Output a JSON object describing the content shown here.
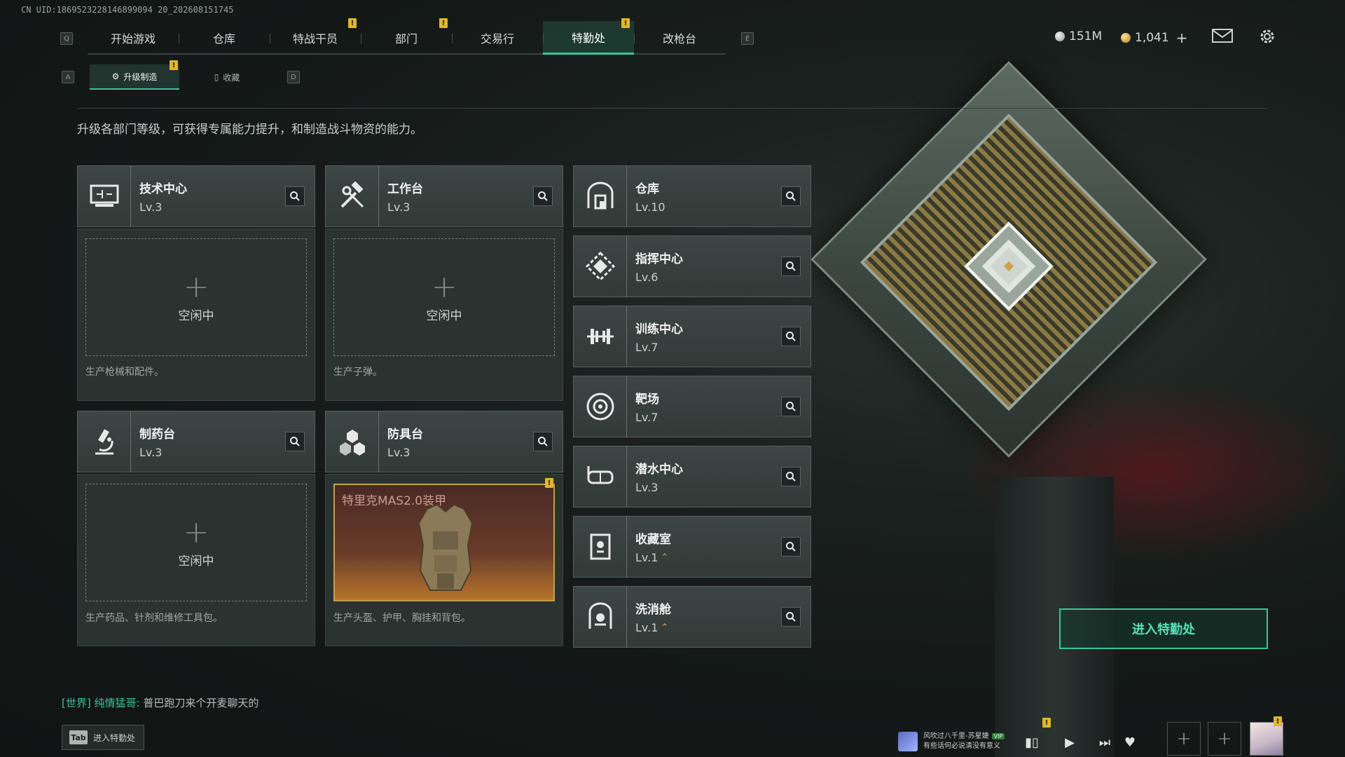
{
  "uid": "CN UID:1869523228146899094 20_202608151745",
  "keys": {
    "q": "Q",
    "e": "E",
    "a": "A",
    "d": "D"
  },
  "topnav": {
    "tabs": [
      {
        "label": "开始游戏"
      },
      {
        "label": "仓库"
      },
      {
        "label": "特战干员",
        "badge": "!"
      },
      {
        "label": "部门",
        "badge": "!"
      },
      {
        "label": "交易行"
      },
      {
        "label": "特勤处",
        "badge": "!",
        "active": true
      },
      {
        "label": "改枪台"
      }
    ]
  },
  "currency": {
    "silver": "151M",
    "gold": "1,041",
    "add": "+"
  },
  "subnav": {
    "tabs": [
      {
        "label": "升级制造",
        "badge": "!",
        "active": true
      },
      {
        "label": "收藏"
      }
    ]
  },
  "description": "升级各部门等级，可获得专属能力提升，和制造战斗物资的能力。",
  "workstations": [
    {
      "name": "技术中心",
      "level": "Lv.3",
      "slot": "空闲中",
      "note": "生产枪械和配件。"
    },
    {
      "name": "工作台",
      "level": "Lv.3",
      "slot": "空闲中",
      "note": "生产子弹。"
    },
    {
      "name": "制药台",
      "level": "Lv.3",
      "slot": "空闲中",
      "note": "生产药品、针剂和维修工具包。"
    },
    {
      "name": "防具台",
      "level": "Lv.3",
      "slot_item": "特里克MAS2.0装甲",
      "badge": "!",
      "note": "生产头盔、护甲、胸挂和背包。"
    }
  ],
  "departments": [
    {
      "name": "仓库",
      "level": "Lv.10"
    },
    {
      "name": "指挥中心",
      "level": "Lv.6"
    },
    {
      "name": "训练中心",
      "level": "Lv.7"
    },
    {
      "name": "靶场",
      "level": "Lv.7"
    },
    {
      "name": "潜水中心",
      "level": "Lv.3"
    },
    {
      "name": "收藏室",
      "level": "Lv.1"
    },
    {
      "name": "洗消舱",
      "level": "Lv.1"
    }
  ],
  "enter_button": "进入特勤处",
  "chat": {
    "channel": "[世界]",
    "user": "纯情猛哥",
    "message": "普巴跑刀来个开麦聊天的"
  },
  "tab_hint": {
    "key": "Tab",
    "label": "进入特勤处"
  },
  "music": {
    "line1": "风吹过八千里-苏星婕",
    "vip": "VIP",
    "line2": "有些话何必说清没有意义"
  },
  "colors": {
    "accent": "#3fc39a",
    "badge": "#e1b52f",
    "slot_border": "#c79c4c"
  }
}
